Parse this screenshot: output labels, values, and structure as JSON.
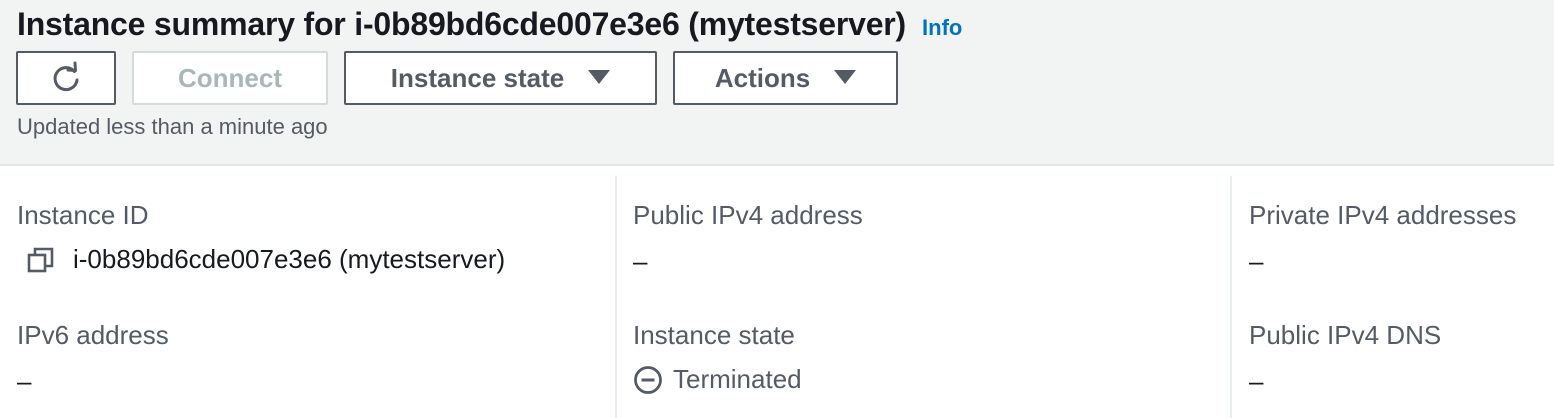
{
  "header": {
    "title": "Instance summary for i-0b89bd6cde007e3e6 (mytestserver)",
    "info_link": "Info",
    "updated_text": "Updated less than a minute ago"
  },
  "toolbar": {
    "refresh_icon": "refresh-icon",
    "connect_label": "Connect",
    "instance_state_label": "Instance state",
    "actions_label": "Actions"
  },
  "details": {
    "instance_id": {
      "label": "Instance ID",
      "value": "i-0b89bd6cde007e3e6 (mytestserver)",
      "icon": "copy-icon"
    },
    "public_ipv4": {
      "label": "Public IPv4 address",
      "value": "–"
    },
    "private_ipv4": {
      "label": "Private IPv4 addresses",
      "value": "–"
    },
    "ipv6": {
      "label": "IPv6 address",
      "value": "–"
    },
    "instance_state": {
      "label": "Instance state",
      "value": "Terminated",
      "icon": "terminated-icon"
    },
    "public_dns": {
      "label": "Public IPv4 DNS",
      "value": "–"
    }
  },
  "colors": {
    "header_bg": "#f2f3f3",
    "link": "#0073bb",
    "text": "#16191f",
    "secondary_text": "#545b64",
    "disabled": "#aab7b8"
  }
}
